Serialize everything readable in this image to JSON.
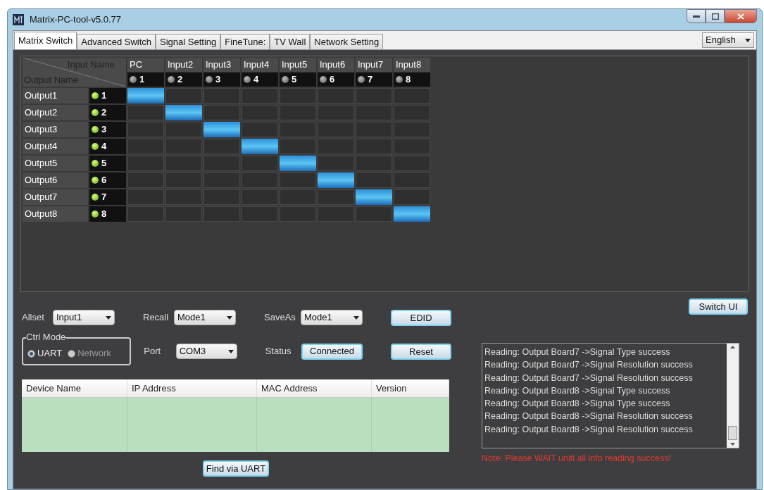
{
  "window": {
    "title": "Matrix-PC-tool-v5.0.77"
  },
  "tabs": [
    {
      "label": "Matrix Switch",
      "selected": true
    },
    {
      "label": "Advanced Switch",
      "selected": false
    },
    {
      "label": "Signal Setting",
      "selected": false
    },
    {
      "label": "FineTune:",
      "selected": false
    },
    {
      "label": "TV Wall",
      "selected": false
    },
    {
      "label": "Network Setting",
      "selected": false
    }
  ],
  "language": {
    "value": "English"
  },
  "matrix": {
    "corner_top": "Input Name",
    "corner_bottom": "Output Name",
    "inputs": [
      {
        "name": "PC",
        "number": "1",
        "lit": false
      },
      {
        "name": "Input2",
        "number": "2",
        "lit": false
      },
      {
        "name": "Input3",
        "number": "3",
        "lit": false
      },
      {
        "name": "Input4",
        "number": "4",
        "lit": false
      },
      {
        "name": "Input5",
        "number": "5",
        "lit": false
      },
      {
        "name": "Input6",
        "number": "6",
        "lit": false
      },
      {
        "name": "Input7",
        "number": "7",
        "lit": false
      },
      {
        "name": "Input8",
        "number": "8",
        "lit": false
      }
    ],
    "outputs": [
      {
        "name": "Output1",
        "number": "1",
        "lit": true,
        "cells": [
          {
            "selected": true
          },
          {
            "selected": false
          },
          {
            "selected": false
          },
          {
            "selected": false
          },
          {
            "selected": false
          },
          {
            "selected": false
          },
          {
            "selected": false
          },
          {
            "selected": false
          }
        ]
      },
      {
        "name": "Output2",
        "number": "2",
        "lit": true,
        "cells": [
          {
            "selected": false
          },
          {
            "selected": true
          },
          {
            "selected": false
          },
          {
            "selected": false
          },
          {
            "selected": false
          },
          {
            "selected": false
          },
          {
            "selected": false
          },
          {
            "selected": false
          }
        ]
      },
      {
        "name": "Output3",
        "number": "3",
        "lit": true,
        "cells": [
          {
            "selected": false
          },
          {
            "selected": false
          },
          {
            "selected": true
          },
          {
            "selected": false
          },
          {
            "selected": false
          },
          {
            "selected": false
          },
          {
            "selected": false
          },
          {
            "selected": false
          }
        ]
      },
      {
        "name": "Output4",
        "number": "4",
        "lit": true,
        "cells": [
          {
            "selected": false
          },
          {
            "selected": false
          },
          {
            "selected": false
          },
          {
            "selected": true
          },
          {
            "selected": false
          },
          {
            "selected": false
          },
          {
            "selected": false
          },
          {
            "selected": false
          }
        ]
      },
      {
        "name": "Output5",
        "number": "5",
        "lit": true,
        "cells": [
          {
            "selected": false
          },
          {
            "selected": false
          },
          {
            "selected": false
          },
          {
            "selected": false
          },
          {
            "selected": true
          },
          {
            "selected": false
          },
          {
            "selected": false
          },
          {
            "selected": false
          }
        ]
      },
      {
        "name": "Output6",
        "number": "6",
        "lit": true,
        "cells": [
          {
            "selected": false
          },
          {
            "selected": false
          },
          {
            "selected": false
          },
          {
            "selected": false
          },
          {
            "selected": false
          },
          {
            "selected": true
          },
          {
            "selected": false
          },
          {
            "selected": false
          }
        ]
      },
      {
        "name": "Output7",
        "number": "7",
        "lit": true,
        "cells": [
          {
            "selected": false
          },
          {
            "selected": false
          },
          {
            "selected": false
          },
          {
            "selected": false
          },
          {
            "selected": false
          },
          {
            "selected": false
          },
          {
            "selected": true
          },
          {
            "selected": false
          }
        ]
      },
      {
        "name": "Output8",
        "number": "8",
        "lit": true,
        "cells": [
          {
            "selected": false
          },
          {
            "selected": false
          },
          {
            "selected": false
          },
          {
            "selected": false
          },
          {
            "selected": false
          },
          {
            "selected": false
          },
          {
            "selected": false
          },
          {
            "selected": true
          }
        ]
      }
    ]
  },
  "switch_ui_button": "Switch UI",
  "allset": {
    "label": "Allset",
    "value": "Input1"
  },
  "recall": {
    "label": "Recall",
    "value": "Mode1"
  },
  "save_as": {
    "label": "SaveAs",
    "value": "Mode1"
  },
  "edid_button": "EDID",
  "ctrl_mode": {
    "title": "Ctrl Mode",
    "options": [
      {
        "label": "UART",
        "selected": true
      },
      {
        "label": "Network",
        "selected": false
      }
    ]
  },
  "port": {
    "label": "Port",
    "value": "COM3"
  },
  "status": {
    "label": "Status",
    "value": "Connected"
  },
  "reset_button": "Reset",
  "device_table": {
    "columns": [
      "Device Name",
      "IP Address",
      "MAC Address",
      "Version"
    ]
  },
  "find_button": "Find via UART",
  "log": [
    "Reading: Output Board7 ->Signal Type success",
    "Reading: Output Board7 ->Signal Resolution success",
    "Reading: Output Board7 ->Signal Resolution success",
    "Reading: Output Board8 ->Signal Type success",
    "Reading: Output Board8 ->Signal Type success",
    "Reading: Output Board8 ->Signal Resolution success",
    "Reading: Output Board8 ->Signal Resolution success"
  ],
  "note": "Note: Please WAIT unitl all info reading success!"
}
